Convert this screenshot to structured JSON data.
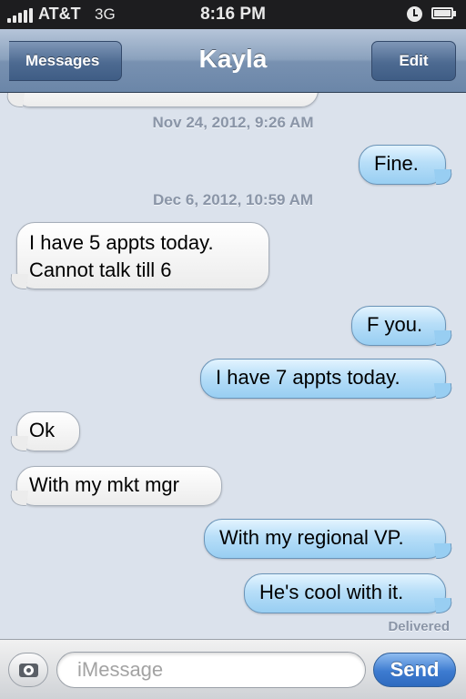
{
  "status_bar": {
    "carrier": "AT&T",
    "network": "3G",
    "time": "8:16 PM"
  },
  "nav": {
    "back_label": "Messages",
    "title": "Kayla",
    "edit_label": "Edit"
  },
  "thread": {
    "timestamps": [
      "Nov 24, 2012, 9:26 AM",
      "Dec 6, 2012, 10:59 AM"
    ],
    "messages": [
      {
        "direction": "out",
        "text": "Fine."
      },
      {
        "direction": "in",
        "line1": "I have 5 appts today.",
        "line2": "Cannot talk till 6"
      },
      {
        "direction": "out",
        "text": "F you."
      },
      {
        "direction": "out",
        "text": "I have 7 appts today."
      },
      {
        "direction": "in",
        "text": "Ok"
      },
      {
        "direction": "in",
        "text": "With my mkt mgr"
      },
      {
        "direction": "out",
        "text": "With my regional VP."
      },
      {
        "direction": "out",
        "text": "He's cool with it."
      }
    ],
    "delivered": "Delivered"
  },
  "input": {
    "placeholder": "iMessage",
    "send_label": "Send"
  },
  "colors": {
    "outgoing_bubble": "#98cef2",
    "incoming_bubble": "#ffffff",
    "send_button": "#3d7bd0",
    "nav_bar": "#7891b1"
  }
}
